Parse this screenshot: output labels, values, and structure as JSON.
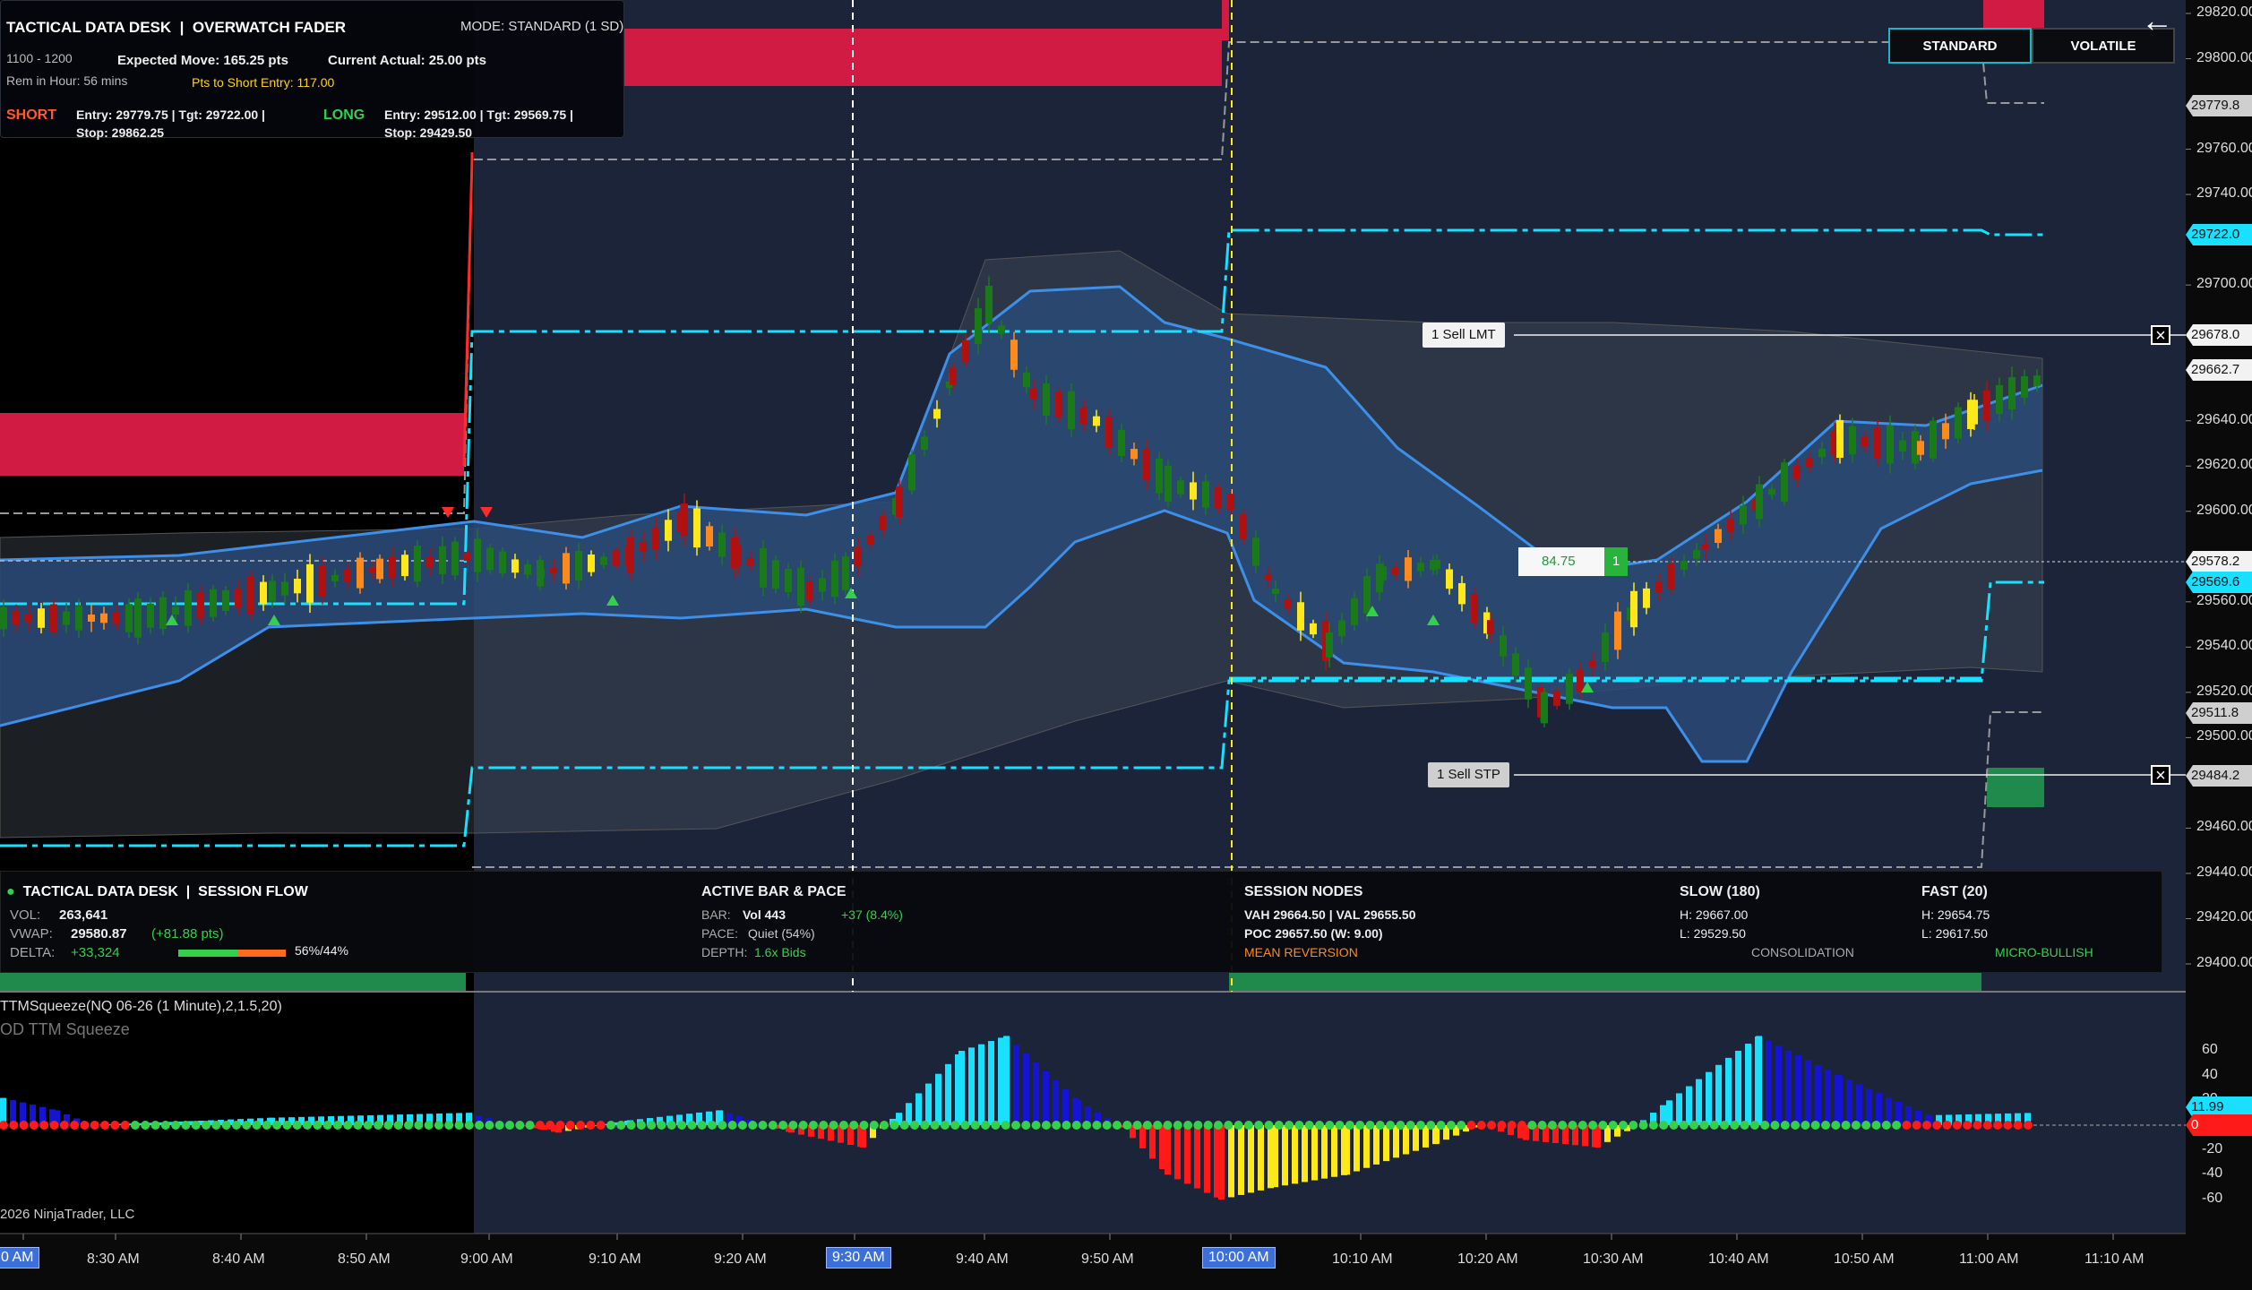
{
  "header": {
    "title": "TACTICAL DATA DESK",
    "subtitle": "OVERWATCH FADER",
    "mode": "MODE: STANDARD (1 SD)",
    "time_range": "1100 - 1200",
    "rem_in_hour": "Rem in Hour: 56 mins",
    "expected_move": "Expected Move: 165.25 pts",
    "current_actual": "Current Actual: 25.00 pts",
    "pts_to_short": "Pts to Short Entry: 117.00",
    "short_label": "SHORT",
    "short_entry": "Entry: 29779.75  |  Tgt: 29722.00  |",
    "short_stop": "Stop: 29862.25",
    "long_label": "LONG",
    "long_entry": "Entry: 29512.00  |  Tgt: 29569.75  |",
    "long_stop": "Stop: 29429.50"
  },
  "buttons": {
    "standard": "STANDARD",
    "volatile": "VOLATILE",
    "back_icon": "back-arrow-icon"
  },
  "orders": {
    "sell_lmt": "1  Sell LMT",
    "sell_stp": "1  Sell STP",
    "position_pnl": "84.75",
    "position_qty": "1",
    "close_icon": "close-icon"
  },
  "price_axis": {
    "labels": [
      "29820.00",
      "29800.00",
      "29760.00",
      "29740.00",
      "29700.00",
      "29640.00",
      "29620.00",
      "29600.00",
      "29560.00",
      "29540.00",
      "29520.00",
      "29500.00",
      "29460.00",
      "29440.00",
      "29420.00",
      "29400.00"
    ],
    "tags": {
      "short_entry": "29779.8",
      "short_target": "29722.0",
      "sell_lmt": "29678.0",
      "last": "29662.7",
      "mid": "29578.2",
      "long_target": "29569.6",
      "long_entry": "29511.8",
      "sell_stp": "29484.2"
    }
  },
  "session_panel": {
    "title": "TACTICAL DATA DESK",
    "subtitle": "SESSION FLOW",
    "vol_label": "VOL:",
    "vol_value": "263,641",
    "vwap_label": "VWAP:",
    "vwap_value": "29580.87",
    "vwap_delta": "(+81.88 pts)",
    "delta_label": "DELTA:",
    "delta_value": "+33,324",
    "delta_ratio": "56%/44%",
    "delta_buy_fraction": 0.56,
    "active_title": "ACTIVE BAR & PACE",
    "bar_label": "BAR:",
    "bar_value": "Vol 443",
    "bar_delta": "+37 (8.4%)",
    "pace_label": "PACE:",
    "pace_value": "Quiet (54%)",
    "depth_label": "DEPTH:",
    "depth_value": "1.6x Bids",
    "nodes_title": "SESSION NODES",
    "vah_val": "VAH 29664.50  |  VAL 29655.50",
    "poc": "POC 29657.50 (W: 9.00)",
    "mean_reversion": "MEAN REVERSION",
    "slow_title": "SLOW (180)",
    "slow_h": "H: 29667.00",
    "slow_l": "L: 29529.50",
    "consolidation": "CONSOLIDATION",
    "fast_title": "FAST (20)",
    "fast_h": "H: 29654.75",
    "fast_l": "L: 29617.50",
    "micro": "MICRO-BULLISH"
  },
  "indicator": {
    "title": "TTMSqueeze(NQ 06-26 (1 Minute),2,1.5,20)",
    "name": "OD TTM Squeeze",
    "copyright": "2026 NinjaTrader, LLC",
    "axis_labels": [
      "60",
      "40",
      "20",
      "-20",
      "-40",
      "-60"
    ],
    "value_tag": "11.99",
    "zero_tag": "0"
  },
  "time_axis": {
    "labels": [
      "0 AM",
      "8:30 AM",
      "8:40 AM",
      "8:50 AM",
      "9:00 AM",
      "9:10 AM",
      "9:20 AM",
      "9:30 AM",
      "9:40 AM",
      "9:50 AM",
      "10:00 AM",
      "10:10 AM",
      "10:20 AM",
      "10:30 AM",
      "10:40 AM",
      "10:50 AM",
      "11:00 AM",
      "11:10 AM"
    ],
    "highlighted": [
      "0 AM",
      "9:30 AM",
      "10:00 AM"
    ]
  },
  "colors": {
    "background": "#1b2438",
    "premarket": "#000000",
    "cyan": "#1ae0ff",
    "band_fill": "#2a4a78",
    "band_line": "#3d8fe8",
    "red_zone": "#d21b43",
    "green_zone": "#1f8a4c",
    "candle_up": "#1a7a1a",
    "candle_down": "#b01010",
    "candle_yellow": "#ffe81a",
    "candle_orange": "#ff8a1c"
  },
  "chart_data": {
    "type": "candlestick",
    "ylim": [
      29390,
      29830
    ],
    "squeeze_ylim": [
      -70,
      75
    ]
  }
}
